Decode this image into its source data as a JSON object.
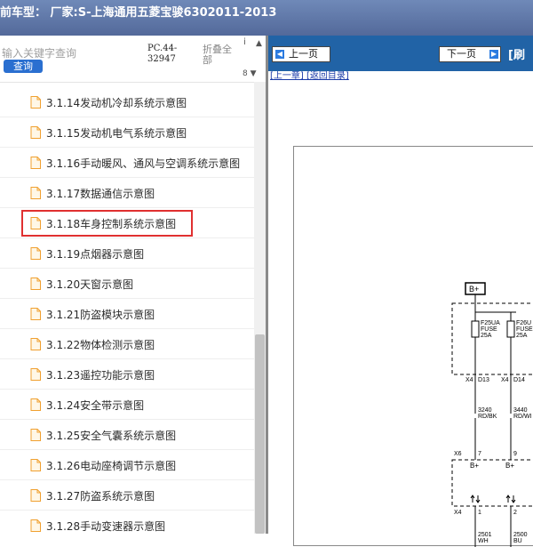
{
  "window": {
    "title": "前车型： 厂家:S-上海通用五菱宝骏6302011-2013"
  },
  "search": {
    "placeholder": "输入关键字查询",
    "button_label": "查询"
  },
  "header": {
    "doc_code": "PC.44-32947",
    "collapse_all": "折叠全部",
    "mini_i": "i",
    "mini_arrow": "▲",
    "mini_b": "8 ▼"
  },
  "tree": {
    "items": [
      {
        "label": "3.1.14发动机冷却系统示意图"
      },
      {
        "label": "3.1.15发动机电气系统示意图"
      },
      {
        "label": "3.1.16手动暖风、通风与空调系统示意图"
      },
      {
        "label": "3.1.17数据通信示意图"
      },
      {
        "label": "3.1.18车身控制系统示意图",
        "selected": true
      },
      {
        "label": "3.1.19点烟器示意图"
      },
      {
        "label": "3.1.20天窗示意图"
      },
      {
        "label": "3.1.21防盗模块示意图"
      },
      {
        "label": "3.1.22物体检测示意图"
      },
      {
        "label": "3.1.23遥控功能示意图"
      },
      {
        "label": "3.1.24安全带示意图"
      },
      {
        "label": "3.1.25安全气囊系统示意图"
      },
      {
        "label": "3.1.26电动座椅调节示意图"
      },
      {
        "label": "3.1.27防盗系统示意图"
      },
      {
        "label": "3.1.28手动变速器示意图"
      }
    ]
  },
  "viewer": {
    "prev_label": "上一页",
    "next_label": "下一页",
    "toolbar_text": "[刷",
    "link_text": "[上一章] [返回目录]"
  },
  "diagram": {
    "labels": {
      "bplus_top": "B+",
      "fuse1_a": "F25UA",
      "fuse1_b": "FUSE",
      "fuse1_c": "25A",
      "fuse2_a": "F26U",
      "fuse2_b": "FUSE",
      "fuse2_c": "25A",
      "x4_1": "X4",
      "d13": "D13",
      "x4_2": "X4",
      "d14": "D14",
      "w1_a": "3240",
      "w1_b": "RD/BK",
      "w2_a": "3440",
      "w2_b": "RD/WI",
      "x6": "X6",
      "pin7": "7",
      "pin9": "9",
      "bplus_a": "B+",
      "bplus_b": "B+",
      "x4_3": "X4",
      "pin1": "1",
      "pin2": "2",
      "w3_a": "2501",
      "w3_b": "WH",
      "w4_a": "2500",
      "w4_b": "BU"
    }
  },
  "colors": {
    "title_bar": "#5d76a8",
    "toolbar": "#2163a6",
    "search_button": "#2a6fd0",
    "highlight": "#e03030",
    "file_icon": "#f0a030"
  }
}
